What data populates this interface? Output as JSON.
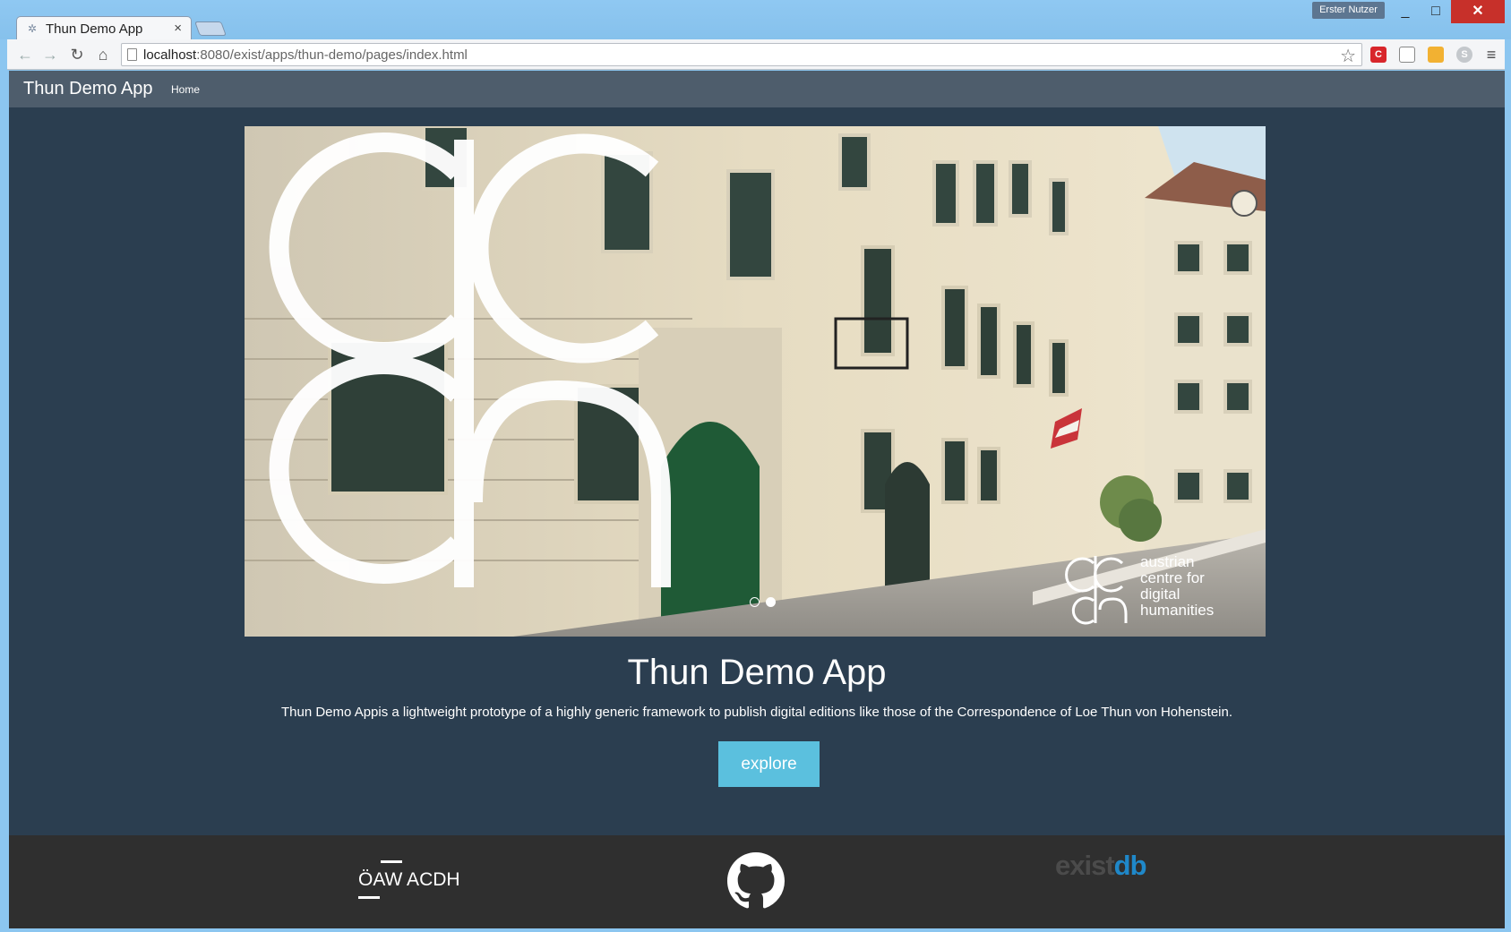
{
  "browser": {
    "tab_title": "Thun Demo App",
    "tab_close": "×",
    "profile_name": "Erster Nutzer",
    "url_host": "localhost",
    "url_rest": ":8080/exist/apps/thun-demo/pages/index.html",
    "window_minimize": "_",
    "window_maximize": "□",
    "window_close": "✕"
  },
  "navbar": {
    "brand": "Thun Demo App",
    "home_link": "Home"
  },
  "carousel": {
    "indicators": [
      "inactive",
      "active"
    ],
    "logo_caption_lines": [
      "austrian",
      "centre for",
      "digital",
      "humanities"
    ]
  },
  "hero": {
    "title": "Thun Demo App",
    "description": "Thun Demo Appis a lightweight prototype of a highly generic framework to publish digital editions like those of the Correspondence of Loe Thun von Hohenstein.",
    "button_label": "explore"
  },
  "footer": {
    "oaw_logo": "ÖAW ACDH",
    "existdb_ex": "exist",
    "existdb_db": "db"
  },
  "colors": {
    "page_bg": "#2b3e50",
    "navbar_bg": "#4e5d6c",
    "button_bg": "#5bc0de",
    "footer_bg": "#2f2f2f",
    "existdb_blue": "#1f88c9"
  }
}
